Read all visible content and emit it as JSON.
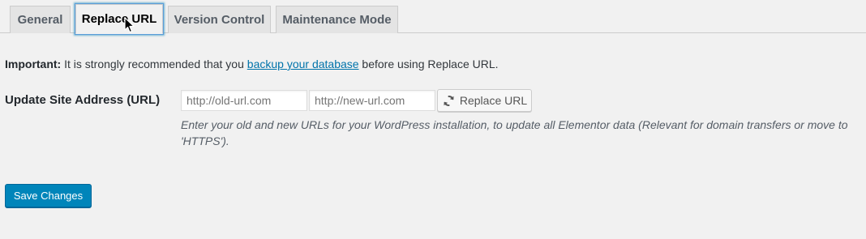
{
  "tabs": [
    {
      "label": "General",
      "active": false
    },
    {
      "label": "Replace URL",
      "active": true
    },
    {
      "label": "Version Control",
      "active": false
    },
    {
      "label": "Maintenance Mode",
      "active": false
    }
  ],
  "notice": {
    "strong": "Important:",
    "before_link": " It is strongly recommended that you ",
    "link": "backup your database",
    "after_link": " before using Replace URL."
  },
  "replace_url": {
    "label": "Update Site Address (URL)",
    "old_placeholder": "http://old-url.com",
    "new_placeholder": "http://new-url.com",
    "button_label": "Replace URL",
    "button_icon": "refresh-icon",
    "description": "Enter your old and new URLs for your WordPress installation, to update all Elementor data (Relevant for domain transfers or move to 'HTTPS')."
  },
  "save_button": "Save Changes",
  "colors": {
    "background": "#f1f1f1",
    "link": "#0073aa",
    "primary_button": "#0085ba",
    "active_tab_focus": "#5b9dd9"
  }
}
